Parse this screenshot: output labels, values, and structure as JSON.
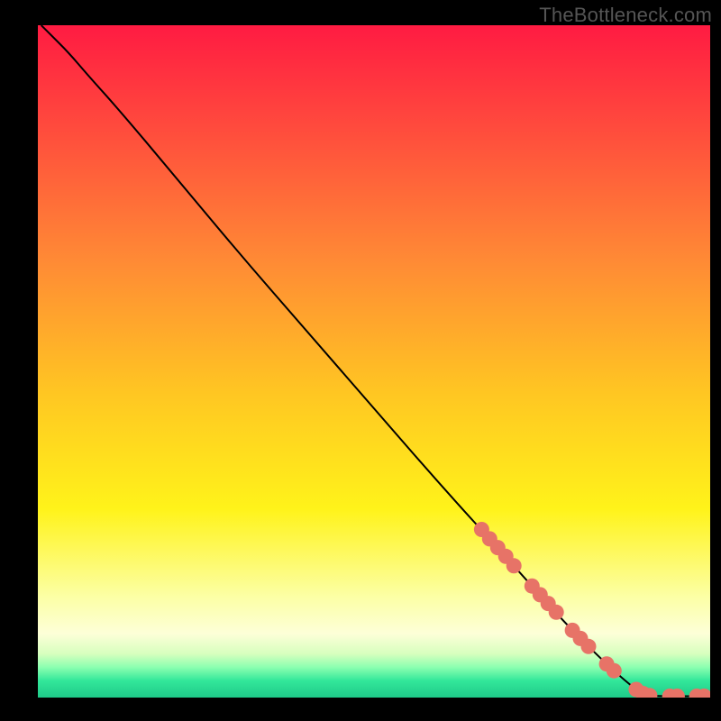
{
  "watermark": "TheBottleneck.com",
  "colors": {
    "frame": "#000000",
    "line": "#000000",
    "marker": "#e77367",
    "gradient_stops": [
      {
        "offset": 0.0,
        "color": "#ff1b42"
      },
      {
        "offset": 0.15,
        "color": "#ff4a3d"
      },
      {
        "offset": 0.35,
        "color": "#ff8a35"
      },
      {
        "offset": 0.55,
        "color": "#ffc722"
      },
      {
        "offset": 0.72,
        "color": "#fff31a"
      },
      {
        "offset": 0.85,
        "color": "#fcffa5"
      },
      {
        "offset": 0.905,
        "color": "#fdffd8"
      },
      {
        "offset": 0.935,
        "color": "#d7ffbe"
      },
      {
        "offset": 0.955,
        "color": "#8bffb0"
      },
      {
        "offset": 0.975,
        "color": "#32e79a"
      },
      {
        "offset": 1.0,
        "color": "#1fca89"
      }
    ]
  },
  "chart_data": {
    "type": "line",
    "xlabel": "",
    "ylabel": "",
    "xlim": [
      0,
      1
    ],
    "ylim": [
      0,
      1
    ],
    "title": "",
    "series": [
      {
        "name": "curve",
        "points": [
          {
            "x": 0.005,
            "y": 1.0
          },
          {
            "x": 0.02,
            "y": 0.985
          },
          {
            "x": 0.045,
            "y": 0.96
          },
          {
            "x": 0.075,
            "y": 0.925
          },
          {
            "x": 0.12,
            "y": 0.875
          },
          {
            "x": 0.2,
            "y": 0.78
          },
          {
            "x": 0.3,
            "y": 0.66
          },
          {
            "x": 0.4,
            "y": 0.545
          },
          {
            "x": 0.5,
            "y": 0.43
          },
          {
            "x": 0.6,
            "y": 0.315
          },
          {
            "x": 0.7,
            "y": 0.205
          },
          {
            "x": 0.78,
            "y": 0.115
          },
          {
            "x": 0.835,
            "y": 0.06
          },
          {
            "x": 0.87,
            "y": 0.028
          },
          {
            "x": 0.89,
            "y": 0.012
          },
          {
            "x": 0.905,
            "y": 0.004
          },
          {
            "x": 0.92,
            "y": 0.002
          },
          {
            "x": 0.95,
            "y": 0.002
          },
          {
            "x": 0.97,
            "y": 0.002
          },
          {
            "x": 0.995,
            "y": 0.002
          }
        ]
      }
    ],
    "markers": [
      {
        "x": 0.66,
        "y": 0.25
      },
      {
        "x": 0.672,
        "y": 0.236
      },
      {
        "x": 0.684,
        "y": 0.223
      },
      {
        "x": 0.696,
        "y": 0.21
      },
      {
        "x": 0.708,
        "y": 0.196
      },
      {
        "x": 0.735,
        "y": 0.166
      },
      {
        "x": 0.747,
        "y": 0.153
      },
      {
        "x": 0.759,
        "y": 0.14
      },
      {
        "x": 0.771,
        "y": 0.127
      },
      {
        "x": 0.795,
        "y": 0.1
      },
      {
        "x": 0.807,
        "y": 0.088
      },
      {
        "x": 0.819,
        "y": 0.076
      },
      {
        "x": 0.846,
        "y": 0.05
      },
      {
        "x": 0.857,
        "y": 0.04
      },
      {
        "x": 0.89,
        "y": 0.012
      },
      {
        "x": 0.9,
        "y": 0.006
      },
      {
        "x": 0.91,
        "y": 0.003
      },
      {
        "x": 0.94,
        "y": 0.002
      },
      {
        "x": 0.951,
        "y": 0.002
      },
      {
        "x": 0.98,
        "y": 0.002
      },
      {
        "x": 0.991,
        "y": 0.002
      }
    ]
  }
}
